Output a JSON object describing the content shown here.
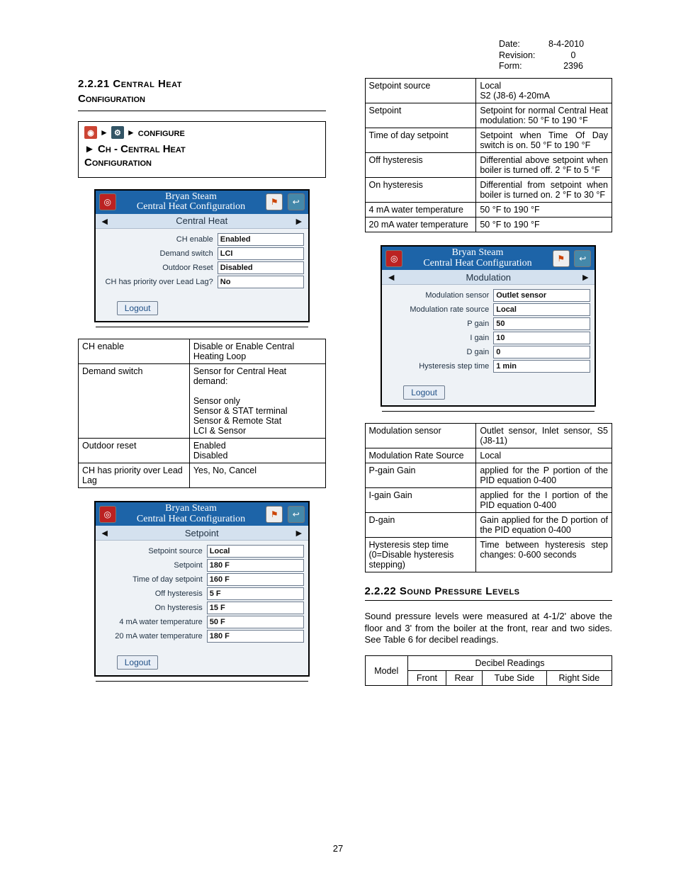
{
  "meta": {
    "date_label": "Date:",
    "date_value": "8-4-2010",
    "rev_label": "Revision:",
    "rev_value": "0",
    "form_label": "Form:",
    "form_value": "2396"
  },
  "page_number": "27",
  "left": {
    "section_num_title": "2.2.21 Central Heat",
    "section_sub": "Configuration",
    "config_word": "configure",
    "config_line2a": "► Ch - Central Heat",
    "config_line2b": "Configuration",
    "panel1": {
      "title1": "Bryan Steam",
      "title2": "Central Heat Configuration",
      "nav": "Central Heat",
      "rows": [
        {
          "label": "CH enable",
          "value": "Enabled"
        },
        {
          "label": "Demand switch",
          "value": "LCI"
        },
        {
          "label": "Outdoor Reset",
          "value": "Disabled"
        },
        {
          "label": "CH has priority over Lead Lag?",
          "value": "No"
        }
      ],
      "logout": "Logout"
    },
    "table1": [
      {
        "a": "CH enable",
        "b": "Disable or Enable Central Heating Loop"
      },
      {
        "a": "Demand switch",
        "b": "Sensor for Central Heat demand:\n\nSensor only\nSensor & STAT terminal\nSensor & Remote Stat\nLCI & Sensor"
      },
      {
        "a": "Outdoor reset",
        "b": "Enabled\nDisabled"
      },
      {
        "a": "CH has priority over Lead Lag",
        "b": "Yes, No, Cancel"
      }
    ],
    "panel2": {
      "title1": "Bryan Steam",
      "title2": "Central Heat Configuration",
      "nav": "Setpoint",
      "rows": [
        {
          "label": "Setpoint source",
          "value": "Local"
        },
        {
          "label": "Setpoint",
          "value": "180 F"
        },
        {
          "label": "Time of day setpoint",
          "value": "160 F"
        },
        {
          "label": "Off hysteresis",
          "value": "5 F"
        },
        {
          "label": "On hysteresis",
          "value": "15 F"
        },
        {
          "label": "4 mA water temperature",
          "value": "50 F"
        },
        {
          "label": "20 mA water temperature",
          "value": "180 F"
        }
      ],
      "logout": "Logout"
    }
  },
  "right": {
    "table_top": [
      {
        "a": "Setpoint source",
        "b": "Local\nS2 (J8-6) 4-20mA"
      },
      {
        "a": "Setpoint",
        "b": "Setpoint for normal Central Heat modulation: 50 °F to 190 °F"
      },
      {
        "a": "Time of day setpoint",
        "b": "Setpoint when Time Of Day switch is on. 50 °F to 190 °F"
      },
      {
        "a": "Off hysteresis",
        "b": "Differential above setpoint when boiler is turned off. 2 °F to 5 °F"
      },
      {
        "a": "On hysteresis",
        "b": "Differential from setpoint when boiler is turned on. 2 °F to 30 °F"
      },
      {
        "a": "4 mA water temperature",
        "b": "50 °F to 190 °F"
      },
      {
        "a": "20 mA water temperature",
        "b": "50 °F to 190 °F"
      }
    ],
    "panel3": {
      "title1": "Bryan Steam",
      "title2": "Central Heat Configuration",
      "nav": "Modulation",
      "rows": [
        {
          "label": "Modulation sensor",
          "value": "Outlet sensor"
        },
        {
          "label": "Modulation rate source",
          "value": "Local"
        },
        {
          "label": "P gain",
          "value": "50"
        },
        {
          "label": "I gain",
          "value": "10"
        },
        {
          "label": "D gain",
          "value": "0"
        },
        {
          "label": "Hysteresis step time",
          "value": "1 min"
        }
      ],
      "logout": "Logout"
    },
    "table_mod": [
      {
        "a": "Modulation sensor",
        "b": "Outlet sensor, Inlet sensor, S5 (J8-11)"
      },
      {
        "a": "Modulation Rate Source",
        "b": "Local"
      },
      {
        "a": "P-gain Gain",
        "b": "applied for the P portion of the PID equation 0-400"
      },
      {
        "a": "I-gain Gain",
        "b": "applied for the I portion of the PID equation 0-400"
      },
      {
        "a": "D-gain",
        "b": "Gain applied for the D portion of the PID equation 0-400"
      },
      {
        "a": "Hysteresis step time (0=Disable hysteresis stepping)",
        "b": "Time between hysteresis step changes: 0-600 seconds"
      }
    ],
    "section2_title": "2.2.22 Sound Pressure Levels",
    "sound_text": "Sound pressure levels were measured at 4-1/2' above the floor and 3' from the boiler at the front, rear and two sides.  See Table 6 for decibel readings.",
    "sound_table": {
      "header_span": "Decibel Readings",
      "cols": [
        "Model",
        "Front",
        "Rear",
        "Tube Side",
        "Right Side"
      ]
    }
  }
}
